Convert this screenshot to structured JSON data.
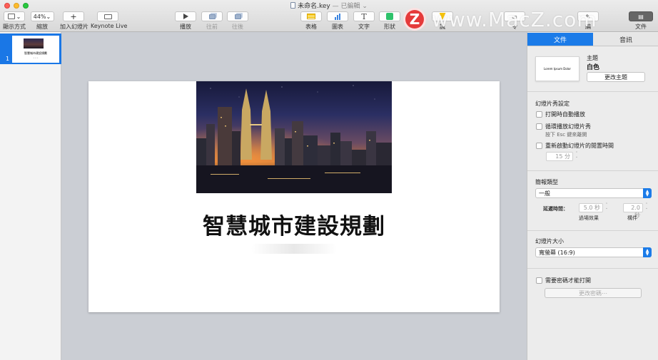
{
  "window": {
    "doc_title": "未命名.key",
    "doc_status": "— 已編輯"
  },
  "toolbar": {
    "view_label": "顯示方式",
    "zoom_value": "44%",
    "zoom_label": "縮放",
    "add_slide_label": "加入幻燈片",
    "keynote_live_label": "Keynote Live",
    "play_label": "播放",
    "front_label": "往前",
    "back_label": "往後",
    "table_label": "表格",
    "chart_label": "圖表",
    "text_label": "文字",
    "shape_label": "形狀",
    "media_label_partial": "諷",
    "comment_label_partial": "令",
    "format_label_partial": "編",
    "document_label_partial": "文件"
  },
  "watermark": {
    "logo_letter": "Z",
    "text": "www.MacZ.com"
  },
  "navigator": {
    "slides": [
      {
        "number": "1",
        "thumb_title": "智慧城市建設規劃",
        "thumb_sub": "• • •"
      }
    ]
  },
  "slide": {
    "title": "智慧城市建設規劃"
  },
  "inspector": {
    "tabs": [
      "文件",
      "音訊"
    ],
    "theme": {
      "heading": "主題",
      "name": "白色",
      "preview_text": "Lorem Ipsum Dolor",
      "change_button": "更改主題"
    },
    "slideshow": {
      "heading": "幻燈片秀設定",
      "autoplay": "打開時自動播放",
      "loop": "循環播放幻燈片秀",
      "loop_note": "按下 Esc 鍵來離開",
      "restart": "重新啟動幻燈片的閒置時間",
      "idle_value": "15 分"
    },
    "presentation": {
      "heading": "簡報類型",
      "type_value": "一般",
      "delay_label": "延遲時間：",
      "transition_value": "5.0 秒",
      "transition_label": "過場效果",
      "build_value": "2.0 秒",
      "build_label": "構件"
    },
    "slide_size": {
      "heading": "幻燈片大小",
      "value": "寬螢幕 (16:9)"
    },
    "password": {
      "require_label": "需要密碼才能打開",
      "change_button": "更改密碼⋯"
    }
  }
}
